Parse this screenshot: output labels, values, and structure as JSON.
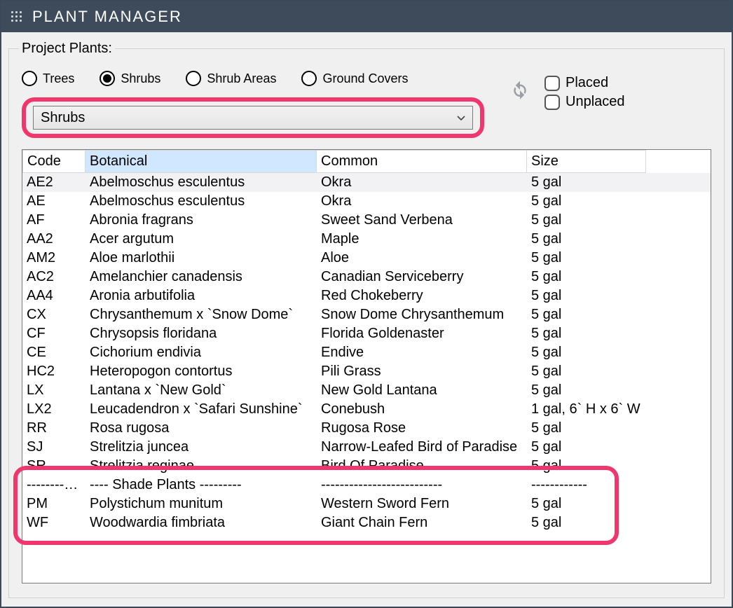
{
  "window": {
    "title": "PLANT MANAGER"
  },
  "fieldset_label": "Project Plants:",
  "radios": [
    {
      "label": "Trees",
      "checked": false
    },
    {
      "label": "Shrubs",
      "checked": true
    },
    {
      "label": "Shrub Areas",
      "checked": false
    },
    {
      "label": "Ground Covers",
      "checked": false
    }
  ],
  "dropdown": {
    "value": "Shrubs"
  },
  "checks": {
    "placed": {
      "label": "Placed",
      "checked": false
    },
    "unplaced": {
      "label": "Unplaced",
      "checked": false
    }
  },
  "table": {
    "columns": [
      "Code",
      "Botanical",
      "Common",
      "Size"
    ],
    "sorted_column_index": 1,
    "rows": [
      {
        "code": "AE2",
        "botanical": "Abelmoschus esculentus",
        "common": "Okra",
        "size": "5 gal",
        "selected": true
      },
      {
        "code": "AE",
        "botanical": "Abelmoschus esculentus",
        "common": "Okra",
        "size": "5 gal"
      },
      {
        "code": "AF",
        "botanical": "Abronia fragrans",
        "common": "Sweet Sand Verbena",
        "size": "5 gal"
      },
      {
        "code": "AA2",
        "botanical": "Acer argutum",
        "common": "Maple",
        "size": "5 gal"
      },
      {
        "code": "AM2",
        "botanical": "Aloe marlothii",
        "common": "Aloe",
        "size": "5 gal"
      },
      {
        "code": "AC2",
        "botanical": "Amelanchier canadensis",
        "common": "Canadian Serviceberry",
        "size": "5 gal"
      },
      {
        "code": "AA4",
        "botanical": "Aronia arbutifolia",
        "common": "Red Chokeberry",
        "size": "5 gal"
      },
      {
        "code": "CX",
        "botanical": "Chrysanthemum x `Snow Dome`",
        "common": "Snow Dome Chrysanthemum",
        "size": "5 gal"
      },
      {
        "code": "CF",
        "botanical": "Chrysopsis floridana",
        "common": "Florida Goldenaster",
        "size": "5 gal"
      },
      {
        "code": "CE",
        "botanical": "Cichorium endivia",
        "common": "Endive",
        "size": "5 gal"
      },
      {
        "code": "HC2",
        "botanical": "Heteropogon contortus",
        "common": "Pili Grass",
        "size": "5 gal"
      },
      {
        "code": "LX",
        "botanical": "Lantana x `New Gold`",
        "common": "New Gold Lantana",
        "size": "5 gal"
      },
      {
        "code": "LX2",
        "botanical": "Leucadendron x `Safari Sunshine`",
        "common": "Conebush",
        "size": "1 gal, 6` H x 6` W"
      },
      {
        "code": "RR",
        "botanical": "Rosa rugosa",
        "common": "Rugosa Rose",
        "size": "5 gal"
      },
      {
        "code": "SJ",
        "botanical": "Strelitzia juncea",
        "common": "Narrow-Leafed Bird of Paradise",
        "size": "5 gal"
      },
      {
        "code": "SR",
        "botanical": "Strelitzia reginae",
        "common": "Bird Of Paradise",
        "size": "5 gal"
      },
      {
        "code": "----------…",
        "botanical": "---- Shade Plants ---------",
        "common": "--------------------------",
        "size": "------------"
      },
      {
        "code": "PM",
        "botanical": "Polystichum munitum",
        "common": "Western Sword Fern",
        "size": "5 gal"
      },
      {
        "code": "WF",
        "botanical": "Woodwardia fimbriata",
        "common": "Giant Chain Fern",
        "size": "5 gal"
      }
    ]
  }
}
